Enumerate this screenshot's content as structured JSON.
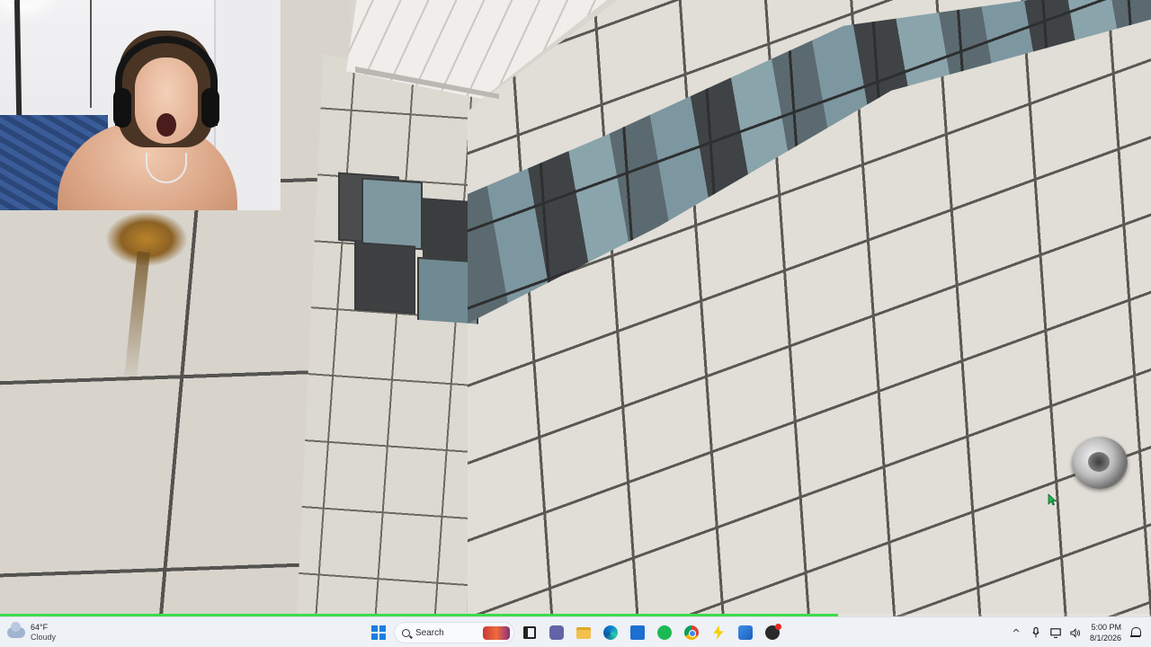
{
  "video": {
    "playback_progress": 0.728
  },
  "taskbar": {
    "weather": {
      "temperature": "64°F",
      "condition": "Cloudy",
      "icon": "cloud-icon"
    },
    "search": {
      "placeholder": "Search"
    },
    "pinned_apps": [
      {
        "name": "Task View",
        "icon": "task-view-icon"
      },
      {
        "name": "Microsoft Teams",
        "icon": "teams-icon"
      },
      {
        "name": "File Explorer",
        "icon": "folder-icon"
      },
      {
        "name": "Microsoft Edge",
        "icon": "edge-icon"
      },
      {
        "name": "Microsoft Store",
        "icon": "store-icon"
      },
      {
        "name": "Spotify",
        "icon": "spotify-icon"
      },
      {
        "name": "Google Chrome",
        "icon": "chrome-icon"
      },
      {
        "name": "Power Automate",
        "icon": "bolt-icon"
      },
      {
        "name": "Photos",
        "icon": "photos-icon"
      },
      {
        "name": "OBS Studio",
        "icon": "obs-icon"
      }
    ],
    "tray": {
      "chevron": "^",
      "time": "5:00 PM",
      "date": "8/1/2026"
    }
  },
  "colors": {
    "progress": "#3ddc4a",
    "taskbar_bg": "#eef1f6",
    "start_blue": "#1a7fdc"
  }
}
